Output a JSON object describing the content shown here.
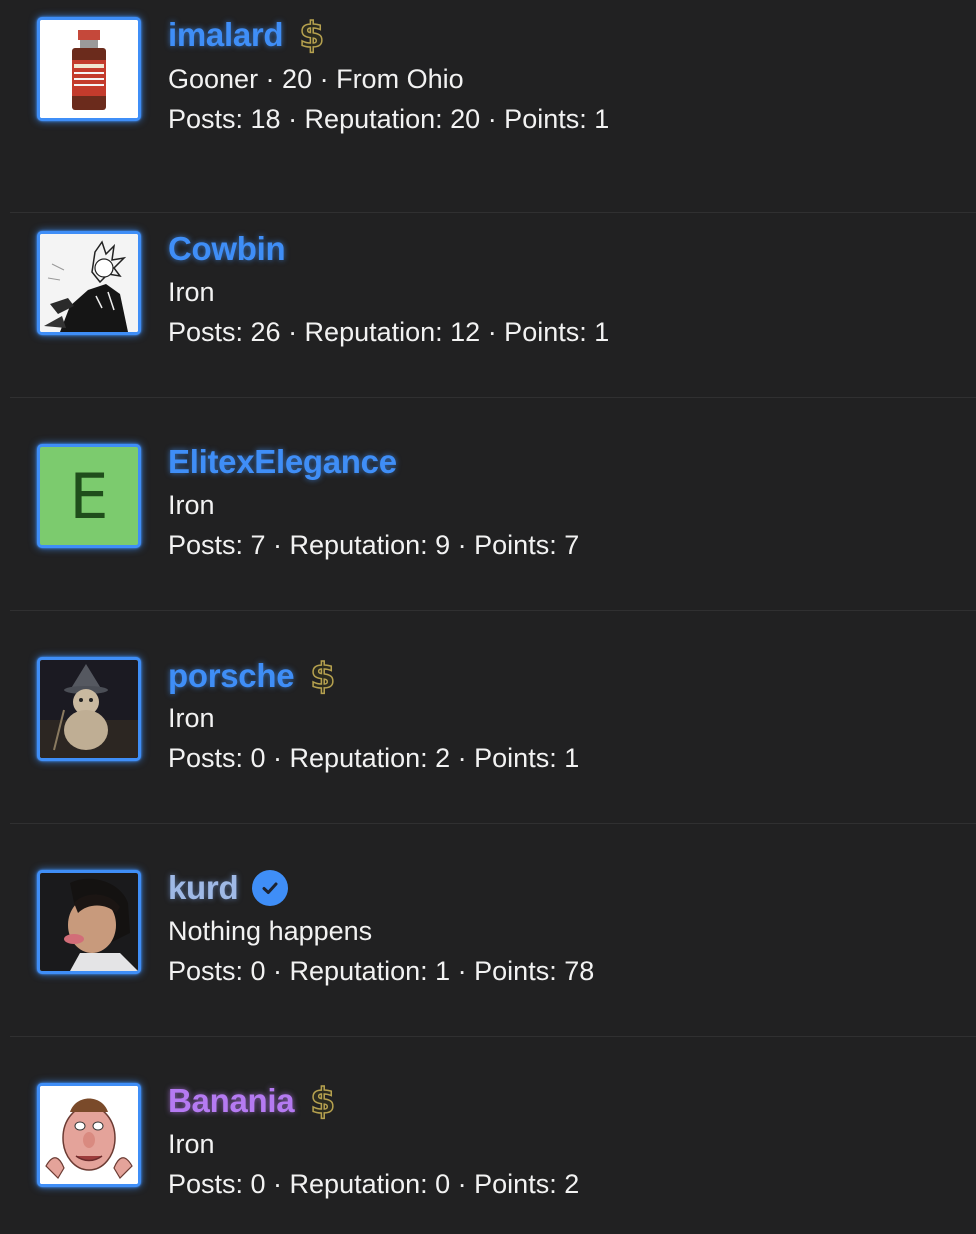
{
  "members": [
    {
      "username": "imalard",
      "name_color": "#3f8ef7",
      "badge": "dollar-icon",
      "subtitle": "Gooner · 20 · From Ohio",
      "stats": "Posts: 18 · Reputation: 20 · Points: 1",
      "avatar": "vial-image"
    },
    {
      "username": "Cowbin",
      "name_color": "#3f8ef7",
      "badge": "",
      "subtitle": "Iron",
      "stats": "Posts: 26 · Reputation: 12 · Points: 1",
      "avatar": "manga-sketch-image"
    },
    {
      "username": "ElitexElegance",
      "name_color": "#3f8ef7",
      "badge": "",
      "subtitle": "Iron",
      "stats": "Posts: 7 · Reputation: 9 · Points: 7",
      "avatar": "E"
    },
    {
      "username": "porsche",
      "name_color": "#3f8ef7",
      "badge": "dollar-icon",
      "subtitle": "Iron",
      "stats": "Posts: 0 · Reputation: 2 · Points: 1",
      "avatar": "wizard-snowman-image"
    },
    {
      "username": "kurd",
      "name_color": "#9fb9e6",
      "badge": "verified-check-icon",
      "subtitle": "Nothing happens",
      "stats": "Posts: 0 · Reputation: 1 · Points: 78",
      "avatar": "person-photo-image"
    },
    {
      "username": "Banania",
      "name_color": "#b57af2",
      "badge": "dollar-icon",
      "subtitle": "Iron",
      "stats": "Posts: 0 · Reputation: 0 · Points: 2",
      "avatar": "cartoon-face-image"
    }
  ]
}
